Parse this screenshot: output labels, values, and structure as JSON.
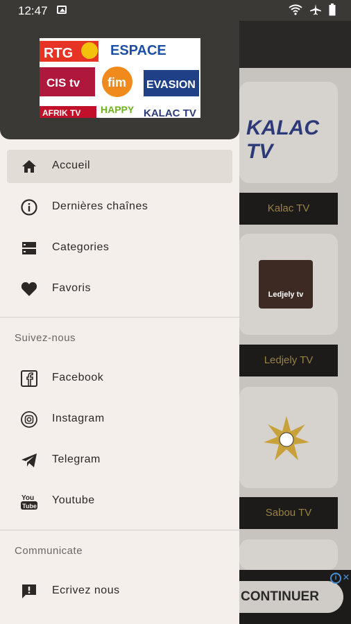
{
  "status_bar": {
    "time": "12:47",
    "right_icons": "wifi-icon airplane-icon battery-icon"
  },
  "drawer": {
    "header": {
      "logo_alt": "RTG TV ESPACE CIS tv fim EVASION AFRIK TV HAPPY KALAC TV"
    },
    "menu": [
      {
        "label": "Accueil",
        "icon": "home-icon",
        "selected": true
      },
      {
        "label": "Dernières chaînes",
        "icon": "info-icon",
        "selected": false
      },
      {
        "label": "Categories",
        "icon": "categories-icon",
        "selected": false
      },
      {
        "label": "Favoris",
        "icon": "heart-icon",
        "selected": false
      }
    ],
    "follow_section": {
      "title": "Suivez-nous",
      "items": [
        {
          "label": "Facebook",
          "icon": "facebook-icon"
        },
        {
          "label": "Instagram",
          "icon": "instagram-icon"
        },
        {
          "label": "Telegram",
          "icon": "telegram-icon"
        },
        {
          "label": "Youtube",
          "icon": "youtube-icon"
        }
      ]
    },
    "communicate_section": {
      "title": "Communicate",
      "items": [
        {
          "label": "Ecrivez nous",
          "icon": "message-icon"
        }
      ]
    }
  },
  "background": {
    "channels": [
      {
        "name": "Kalac TV",
        "logo_text": "KALAC TV"
      },
      {
        "name": "Ledjely TV",
        "logo_text": "Ledjely tv"
      },
      {
        "name": "Sabou TV",
        "logo_text": ""
      }
    ],
    "ad": {
      "button_label": "CONTINUER"
    }
  }
}
